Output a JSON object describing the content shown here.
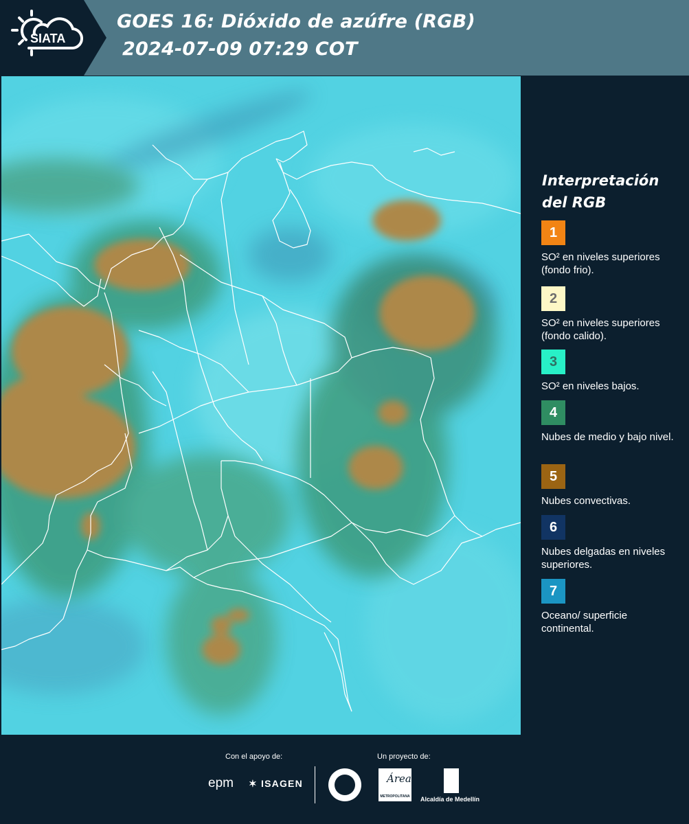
{
  "header": {
    "logo_text": "SIATA",
    "title_line1": "GOES 16: Dióxido de azúfre (RGB)",
    "title_line2": "2024-07-09 07:29 COT"
  },
  "map": {
    "ocean_color": "#52d2e2",
    "surface_color": "#5fd6e3",
    "convective_color": "#a8864a",
    "midlevel_color": "#3f9a7a",
    "border_color": "#ffffff"
  },
  "legend": {
    "title_line1": "Interpretación",
    "title_line2": "del RGB",
    "items": [
      {
        "number": "1",
        "color": "#f28414",
        "text_color": "#ffffff",
        "label": "SO² en niveles superiores (fondo frio)."
      },
      {
        "number": "2",
        "color": "#fdf7c6",
        "text_color": "#6d6d6d",
        "label": "SO² en niveles superiores (fondo calido)."
      },
      {
        "number": "3",
        "color": "#28f0c7",
        "text_color": "#2f6f62",
        "label": "SO² en niveles bajos."
      },
      {
        "number": "4",
        "color": "#2f8d62",
        "text_color": "#ffffff",
        "label": "Nubes de medio y bajo nivel."
      },
      {
        "number": "5",
        "color": "#9b6413",
        "text_color": "#ffffff",
        "label": "Nubes convectivas."
      },
      {
        "number": "6",
        "color": "#113463",
        "text_color": "#ffffff",
        "label": "Nubes delgadas en niveles superiores."
      },
      {
        "number": "7",
        "color": "#1b95c3",
        "text_color": "#ffffff",
        "label": "Oceano/ superficie continental."
      }
    ]
  },
  "footer": {
    "support_caption": "Con el apoyo de:",
    "project_caption": "Un proyecto de:",
    "epm_label": "epm",
    "isagen_label": "ISAGEN",
    "area_label": "METROPOLITANA",
    "area_script": "Área",
    "alcaldia_label": "Alcaldía de Medellín"
  }
}
